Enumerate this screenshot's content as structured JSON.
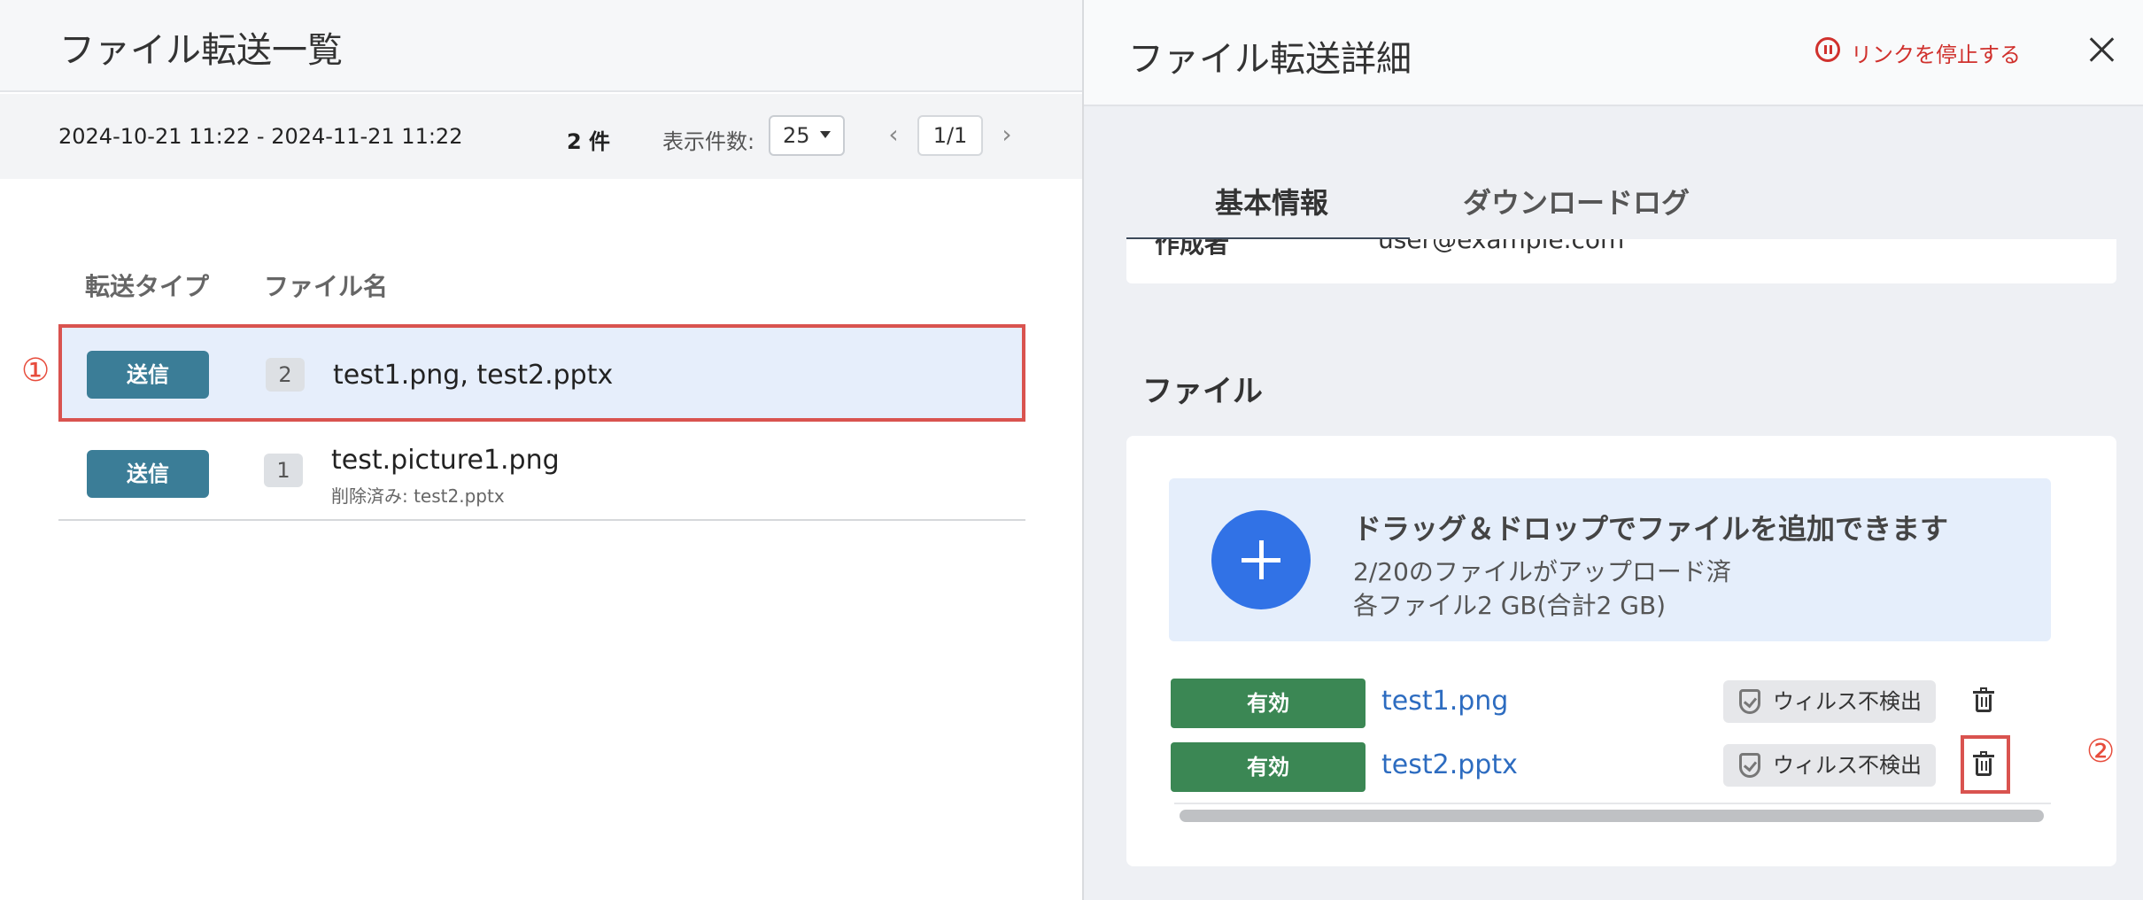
{
  "list": {
    "title": "ファイル転送一覧",
    "date_range": "2024-10-21 11:22 - 2024-11-21 11:22",
    "count": "2 件",
    "per_page_label": "表示件数:",
    "per_page_value": "25",
    "pager": "1/1",
    "columns": {
      "type": "転送タイプ",
      "name": "ファイル名"
    },
    "rows": [
      {
        "type": "送信",
        "file_count": "2",
        "files": "test1.png, test2.pptx",
        "deleted": ""
      },
      {
        "type": "送信",
        "file_count": "1",
        "files": "test.picture1.png",
        "deleted": "削除済み: test2.pptx"
      }
    ],
    "marker": "①"
  },
  "detail": {
    "title": "ファイル転送詳細",
    "stop_link": "リンクを停止する",
    "tabs": [
      "基本情報",
      "ダウンロードログ"
    ],
    "info": {
      "label": "作成者",
      "value": "user@example.com"
    },
    "files_section": "ファイル",
    "dropzone": {
      "title": "ドラッグ＆ドロップでファイルを追加できます",
      "line1": "2/20のファイルがアップロード済",
      "line2": "各ファイル2 GB(合計2 GB)"
    },
    "files": [
      {
        "status": "有効",
        "name": "test1.png",
        "virus": "ウィルス不検出"
      },
      {
        "status": "有効",
        "name": "test2.pptx",
        "virus": "ウィルス不検出"
      }
    ],
    "marker": "②"
  },
  "colors": {
    "type_button": "#3b7d97",
    "status_button": "#3b8754",
    "accent_blue": "#3172e6",
    "link": "#2d6cc0",
    "danger": "#d0312d",
    "highlight_border": "#d9534f"
  }
}
